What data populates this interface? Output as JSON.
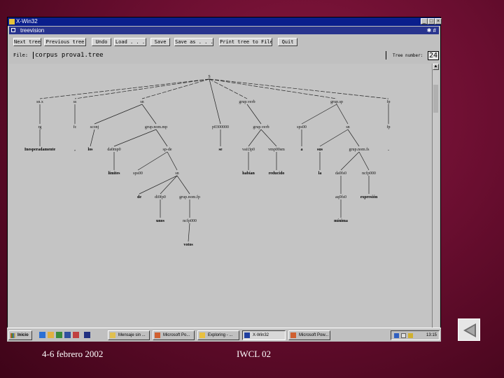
{
  "window": {
    "title": "X-Win32",
    "controls": [
      "_",
      "□",
      "×"
    ]
  },
  "app": {
    "title": "treevision",
    "title_right": "✱ #"
  },
  "toolbar": {
    "buttons": [
      "Next tree",
      "Previous tree",
      "Undo",
      "Load . . .",
      "Save",
      "Save as . . .",
      "Print tree to File",
      "Quit"
    ]
  },
  "fileinfo": {
    "file_label": "File:",
    "file_value": "corpus prova1.tree",
    "tree_number_label": "Tree number:",
    "tree_number": "24"
  },
  "tree": {
    "root": "S",
    "nodes": {
      "n1": "sn.x",
      "n2": "ss",
      "n3": "sn",
      "n4": "grup.verb",
      "n5": "grup.sp",
      "n6": "fp",
      "n7": "rg",
      "n8": "fc",
      "n9": "sconj",
      "n10": "grup.nom.mp",
      "n11": "p0300000",
      "n12": "grup.verb",
      "n13": "sps00",
      "n14": "sn",
      "n15": "fp",
      "n16": "da0mp0",
      "n17": "sp-de",
      "n18": "vaii3p0",
      "n19": "vmp00sm",
      "n20": "d",
      "n21": "grup.nom.fs",
      "n22": "sps00",
      "n23": "sn",
      "n24": "da0fs0",
      "n25": "aq0fs0",
      "n26": "di0fp0",
      "n27": "grup.nom.fp",
      "n28": "aq0fs0",
      "n29": "ncfp000",
      "n30": "ncfs000"
    },
    "leaves": {
      "w1": "Inesperadamente",
      "w2": ",",
      "w3": "los",
      "w4": "límites",
      "w5": "de",
      "w6": "se",
      "w7": "habían",
      "w8": "reducido",
      "w9": "a",
      "w10": "sus",
      "w11": "la",
      "w12": "expresión",
      "w13": "mínima",
      "w14": "unos",
      "w15": "votos",
      "w16": "."
    }
  },
  "taskbar": {
    "start": "Inicio",
    "tasks": [
      "Mensaje sin ...",
      "Microsoft Po...",
      "Exploring - ...",
      "X-Win32",
      "Microsoft Pow..."
    ],
    "clock": "13:15"
  },
  "slide": {
    "date": "4-6 febrero 2002",
    "event": "IWCL 02"
  },
  "colors": {
    "background": "#6a0e30",
    "window_title": "#0a1e8c",
    "app_title": "#28348e"
  }
}
